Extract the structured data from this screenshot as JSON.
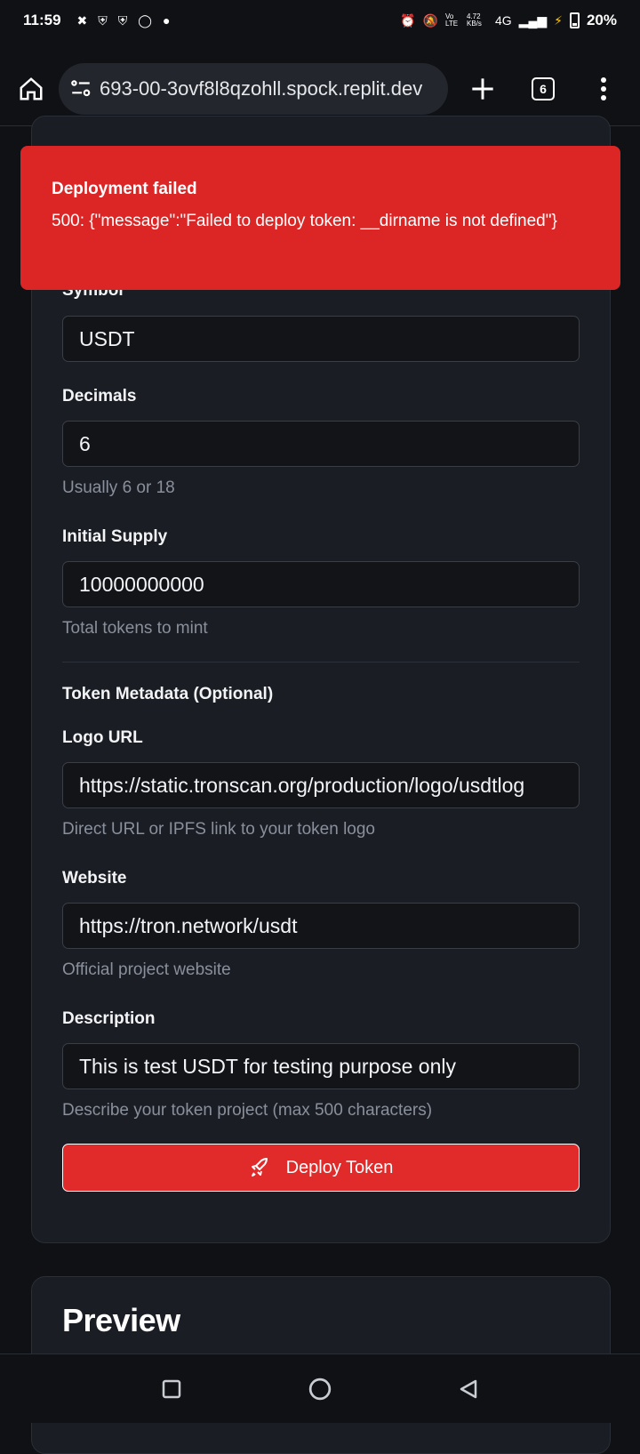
{
  "status_bar": {
    "time": "11:59",
    "left_icons": [
      "cross-icon",
      "shield-icon",
      "shield-icon",
      "whatsapp-icon",
      "dot-icon"
    ],
    "net_speed": "4.72 KB/s",
    "network": "4G",
    "volte": "Vo LTE",
    "battery_percent": "20%"
  },
  "browser": {
    "url": "693-00-3ovf8l8qzohll.spock.replit.dev",
    "tab_count": "6"
  },
  "toast": {
    "title": "Deployment failed",
    "message": "500: {\"message\":\"Failed to deploy token: __dirname is not defined\"}",
    "color": "#dc2626"
  },
  "form": {
    "symbol": {
      "label": "Symbol",
      "value": "USDT"
    },
    "decimals": {
      "label": "Decimals",
      "value": "6",
      "hint": "Usually 6 or 18"
    },
    "initial_supply": {
      "label": "Initial Supply",
      "value": "10000000000",
      "hint": "Total tokens to mint"
    },
    "metadata_heading": "Token Metadata (Optional)",
    "logo_url": {
      "label": "Logo URL",
      "value": "https://static.tronscan.org/production/logo/usdtlog",
      "hint": "Direct URL or IPFS link to your token logo"
    },
    "website": {
      "label": "Website",
      "value": "https://tron.network/usdt",
      "hint": "Official project website"
    },
    "description": {
      "label": "Description",
      "value": "This is test USDT for testing purpose only",
      "hint": "Describe your token project (max 500 characters)"
    },
    "deploy_button": "Deploy Token"
  },
  "preview": {
    "title": "Preview"
  },
  "colors": {
    "accent": "#e12a2a",
    "background": "#0f1115",
    "card": "#1a1d24"
  }
}
